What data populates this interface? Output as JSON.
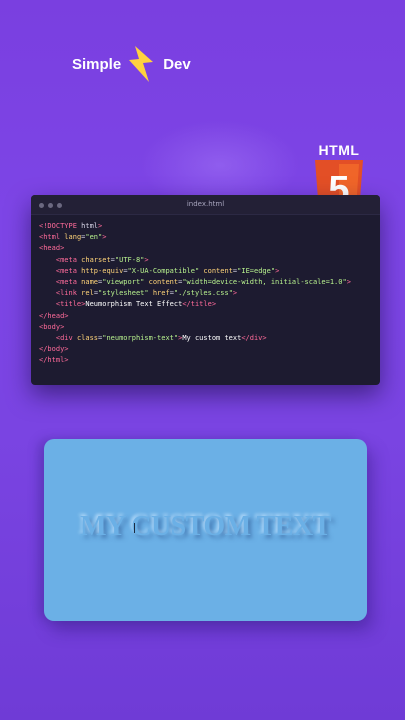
{
  "brand": {
    "left_word": "Simple",
    "right_word": "Dev",
    "icon": "lightning-bolt-icon",
    "icon_color": "#ffd23f"
  },
  "badge": {
    "word": "HTML",
    "number": "5",
    "icon": "html5-shield-icon",
    "color": "#e34f26"
  },
  "editor": {
    "filename": "index.html",
    "lines": [
      "<!DOCTYPE html>",
      "<html lang=\"en\">",
      "<head>",
      "    <meta charset=\"UTF-8\">",
      "    <meta http-equiv=\"X-UA-Compatible\" content=\"IE=edge\">",
      "    <meta name=\"viewport\" content=\"width=device-width, initial-scale=1.0\">",
      "    <link rel=\"stylesheet\" href=\"./styles.css\">",
      "    <title>Neumorphism Text Effect</title>",
      "</head>",
      "<body>",
      "    <div class=\"neumorphism-text\">My custom text</div>",
      "</body>",
      "</html>"
    ]
  },
  "preview": {
    "text": "My custom text",
    "background": "#6bb0e6"
  }
}
